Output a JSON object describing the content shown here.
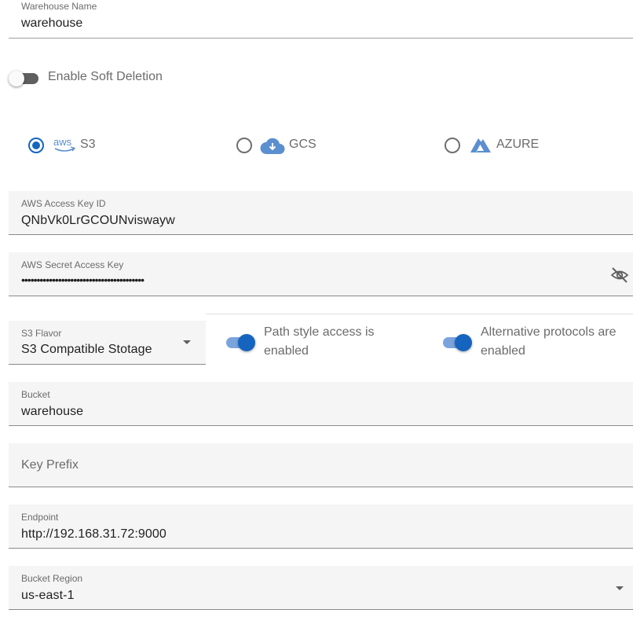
{
  "warehouse_name": {
    "label": "Warehouse Name",
    "value": "warehouse"
  },
  "soft_deletion": {
    "label": "Enable Soft Deletion",
    "enabled": false
  },
  "providers": [
    {
      "logo_text": "aws",
      "label": "S3",
      "selected": true,
      "icon": "aws-icon"
    },
    {
      "label": "GCS",
      "selected": false,
      "icon": "cloud-icon"
    },
    {
      "label": "AZURE",
      "selected": false,
      "icon": "azure-icon"
    }
  ],
  "access_key": {
    "label": "AWS Access Key ID",
    "value": "QNbVk0LrGCOUNviswayw"
  },
  "secret_key": {
    "label": "AWS Secret Access Key",
    "value": "••••••••••••••••••••••••••••••••••••••••",
    "visibility_icon": "eye-off-icon"
  },
  "s3_flavor": {
    "label": "S3 Flavor",
    "value": "S3 Compatible Stotage"
  },
  "path_style": {
    "line1": "Path style access is",
    "line2": "enabled",
    "enabled": true
  },
  "alt_protocols": {
    "line1": "Alternative protocols are",
    "line2": "enabled",
    "enabled": true
  },
  "bucket": {
    "label": "Bucket",
    "value": "warehouse"
  },
  "key_prefix": {
    "placeholder": "Key Prefix",
    "value": ""
  },
  "endpoint": {
    "label": "Endpoint",
    "value": "http://192.168.31.72:9000"
  },
  "bucket_region": {
    "label": "Bucket Region",
    "value": "us-east-1"
  },
  "colors": {
    "accent": "#1565c0",
    "accent_light": "#7ba4dc",
    "field_bg": "#f5f5f5",
    "icon_blue": "#5b8fcf"
  }
}
